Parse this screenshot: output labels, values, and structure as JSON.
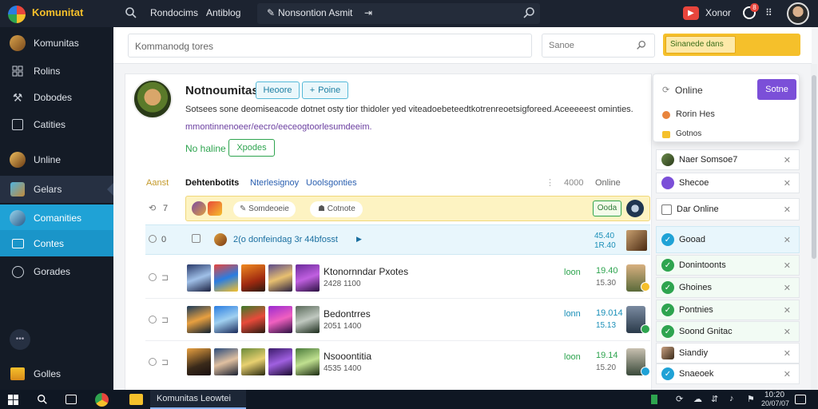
{
  "app": {
    "name": "Komunitat"
  },
  "topbar": {
    "nav1": "Rondocims",
    "nav2": "Antiblog",
    "nav3": "Nonsontion Asmit",
    "notif_badge": "8",
    "user_label": "Xonor"
  },
  "sidebar": {
    "items": [
      {
        "label": "Komunitas",
        "icon": "community-avatar-icon"
      },
      {
        "label": "Rolins",
        "icon": "grid-icon"
      },
      {
        "label": "Dobodes",
        "icon": "tools-icon"
      },
      {
        "label": "Catities",
        "icon": "square-icon"
      },
      {
        "label": "Unline",
        "icon": "online-avatar-icon"
      },
      {
        "label": "Gelars",
        "icon": "games-icon"
      },
      {
        "label": "Comanities",
        "icon": "community-icon"
      },
      {
        "label": "Contes",
        "icon": "screen-icon"
      },
      {
        "label": "Gorades",
        "icon": "globe-icon"
      },
      {
        "label": "Golles",
        "icon": "gallery-icon"
      }
    ]
  },
  "search": {
    "main_placeholder": "Kommanodg tores",
    "mini_placeholder": "Sanoe",
    "action_label": "Sinanede dans"
  },
  "profile": {
    "name": "Notnoumitas",
    "btn_follow": "Heoore",
    "btn_join": "Poine",
    "desc1": "Sotsees sone deomiseacode dotnet osty tior thidoler yed viteadoebeteedtkotrenreoetsigforeed.Aceeeeest ominties.",
    "desc2": "mmontinnenoeer/eecro/eeceogtoorlesumdeeim.",
    "status": "No haline",
    "status_btn": "Xpodes"
  },
  "tabs": {
    "t1": "Aanst",
    "t2": "Dehtenbotits",
    "t3": "Nterlesignoy",
    "t4": "Uoolsgonties",
    "count": "4000",
    "online": "Online"
  },
  "feed": {
    "pin_row": {
      "num": "7",
      "chip1": "Somdeoeie",
      "chip2": "Cotnote",
      "action": "Ooda"
    },
    "info_row": {
      "num": "0",
      "text": "2(o donfeindag 3r 44bfosst",
      "value1": "45.40",
      "value2": "1R.40"
    },
    "rows": [
      {
        "title": "Ktonornndar Pxotes",
        "sub": "2428 1100",
        "status": "loon",
        "v1": "19.40",
        "v2": "15.30"
      },
      {
        "title": "Bedontrres",
        "sub": "2051 1400",
        "status": "lonn",
        "v1": "19.014",
        "v2": "15.13"
      },
      {
        "title": "Nsooontitia",
        "sub": "4535 1400",
        "status": "loon",
        "v1": "19.14",
        "v2": "15.20"
      }
    ]
  },
  "online_panel": {
    "title": "Online",
    "button": "Sotne",
    "items": [
      "Rorin Hes",
      "Gotnos"
    ]
  },
  "right_list": [
    {
      "label": "Naer Somsoe7",
      "type": "avatar"
    },
    {
      "label": "Shecoe",
      "type": "purple"
    },
    {
      "label": "Dar Online",
      "type": "outline"
    },
    {
      "label": "Gooad",
      "type": "blue"
    },
    {
      "label": "Donintoonts",
      "type": "green"
    },
    {
      "label": "Ghoines",
      "type": "green"
    },
    {
      "label": "Pontnies",
      "type": "green"
    },
    {
      "label": "Soond Gnitac",
      "type": "green"
    },
    {
      "label": "Siandiy",
      "type": "avatar"
    },
    {
      "label": "Snaeoek",
      "type": "blue"
    }
  ],
  "taskbar": {
    "active_window": "Komunitas Leowtei",
    "time": "10:20",
    "date": "20/07/07"
  },
  "colors": {
    "accent": "#2aa3cc",
    "topbar": "#1c2330",
    "sidebar": "#141b26",
    "active": "#1fa2d6",
    "yellow": "#f5c02b",
    "purple": "#7b4fd8",
    "green": "#2ea44f"
  }
}
